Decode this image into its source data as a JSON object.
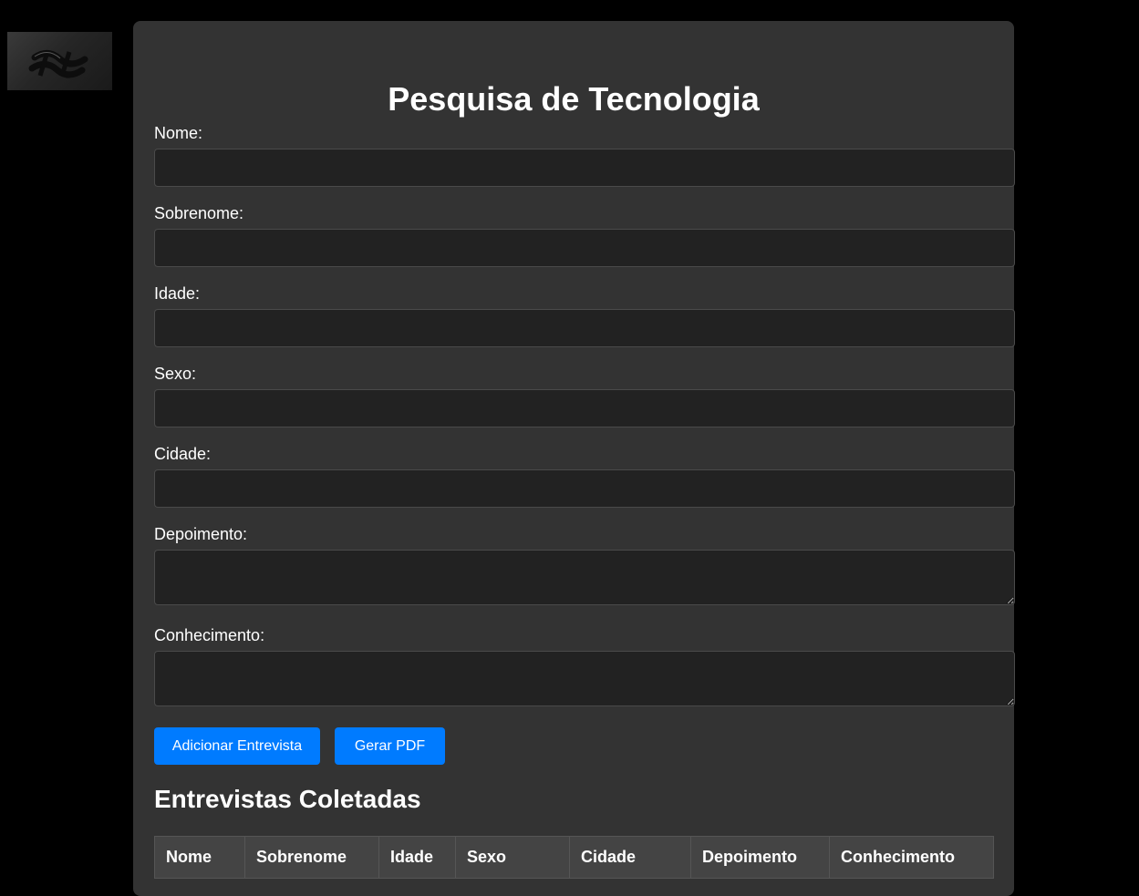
{
  "header": {
    "title": "Pesquisa de Tecnologia"
  },
  "form": {
    "fields": [
      {
        "label": "Nome:",
        "value": "",
        "placeholder": ""
      },
      {
        "label": "Sobrenome:",
        "value": "",
        "placeholder": ""
      },
      {
        "label": "Idade:",
        "value": "",
        "placeholder": ""
      },
      {
        "label": "Sexo:",
        "value": "",
        "placeholder": ""
      },
      {
        "label": "Cidade:",
        "value": "",
        "placeholder": ""
      },
      {
        "label": "Depoimento:",
        "value": "",
        "placeholder": ""
      },
      {
        "label": "Conhecimento:",
        "value": "",
        "placeholder": ""
      }
    ],
    "add_button_label": "Adicionar Entrevista",
    "pdf_button_label": "Gerar PDF"
  },
  "results": {
    "title": "Entrevistas Coletadas",
    "columns": [
      "Nome",
      "Sobrenome",
      "Idade",
      "Sexo",
      "Cidade",
      "Depoimento",
      "Conhecimento"
    ]
  },
  "colors": {
    "page_background": "#000000",
    "panel_background": "#333333",
    "input_background": "#222222",
    "accent": "#007bff",
    "table_header_background": "#444444"
  }
}
